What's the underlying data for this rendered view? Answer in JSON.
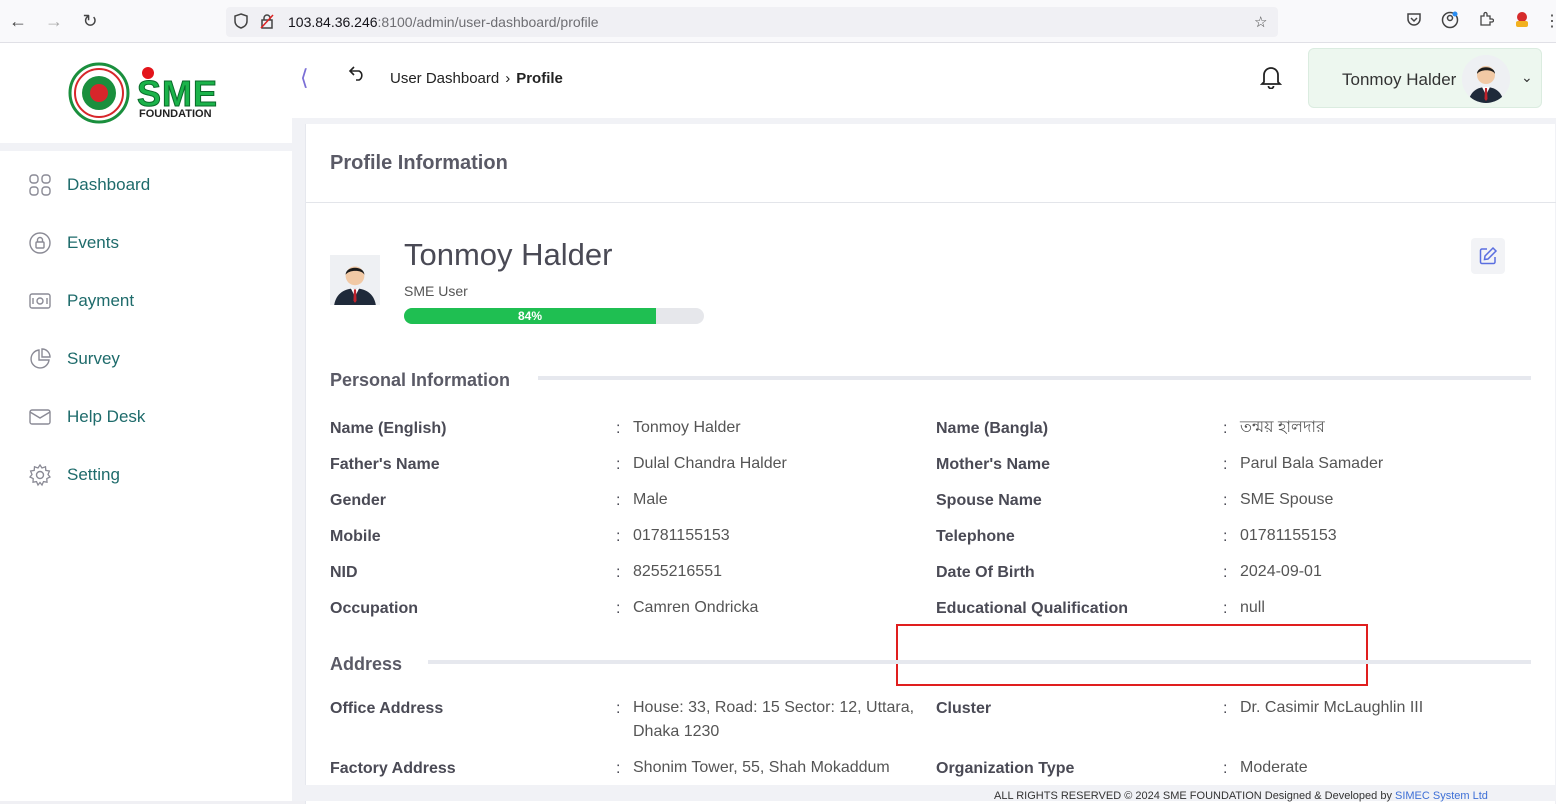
{
  "browser": {
    "url_host": "103.84.36.246",
    "url_rest": ":8100/admin/user-dashboard/profile"
  },
  "brand": {
    "logo_text": "SME",
    "logo_sub": "FOUNDATION"
  },
  "sidebar": {
    "items": [
      {
        "label": "Dashboard",
        "icon": "grid-icon"
      },
      {
        "label": "Events",
        "icon": "lock-circle-icon"
      },
      {
        "label": "Payment",
        "icon": "money-icon"
      },
      {
        "label": "Survey",
        "icon": "pie-chart-icon"
      },
      {
        "label": "Help Desk",
        "icon": "mail-icon"
      },
      {
        "label": "Setting",
        "icon": "gear-icon"
      }
    ]
  },
  "header": {
    "breadcrumb_parent": "User Dashboard",
    "breadcrumb_current": "Profile",
    "user_name": "Tonmoy Halder"
  },
  "card": {
    "title": "Profile Information",
    "profile_name": "Tonmoy Halder",
    "profile_role": "SME User",
    "completion_label": "84%",
    "completion_value": 84
  },
  "personal": {
    "title": "Personal Information",
    "fields": [
      {
        "label": "Name (English)",
        "value": "Tonmoy Halder"
      },
      {
        "label": "Name (Bangla)",
        "value": "তন্ময় হালদার"
      },
      {
        "label": "Father's Name",
        "value": "Dulal Chandra Halder"
      },
      {
        "label": "Mother's Name",
        "value": "Parul Bala Samader"
      },
      {
        "label": "Gender",
        "value": "Male"
      },
      {
        "label": "Spouse Name",
        "value": "SME Spouse"
      },
      {
        "label": "Mobile",
        "value": "01781155153"
      },
      {
        "label": "Telephone",
        "value": "01781155153"
      },
      {
        "label": "NID",
        "value": "8255216551"
      },
      {
        "label": "Date Of Birth",
        "value": "2024-09-01"
      },
      {
        "label": "Occupation",
        "value": "Camren Ondricka"
      },
      {
        "label": "Educational Qualification",
        "value": "null"
      }
    ]
  },
  "address": {
    "title": "Address",
    "fields": [
      {
        "label": "Office Address",
        "value_line1": "House: 33, Road: 15 Sector: 12, Uttara,",
        "value_line2": "Dhaka 1230"
      },
      {
        "label": "Cluster",
        "value": "Dr. Casimir McLaughlin III"
      },
      {
        "label": "Factory Address",
        "value": "Shonim Tower, 55, Shah Mokaddum"
      },
      {
        "label": "Organization Type",
        "value": "Moderate"
      }
    ]
  },
  "footer": {
    "text": "ALL RIGHTS RESERVED © 2024 SME FOUNDATION   Designed & Developed by ",
    "link": "SIMEC System Ltd"
  },
  "colon": ":"
}
